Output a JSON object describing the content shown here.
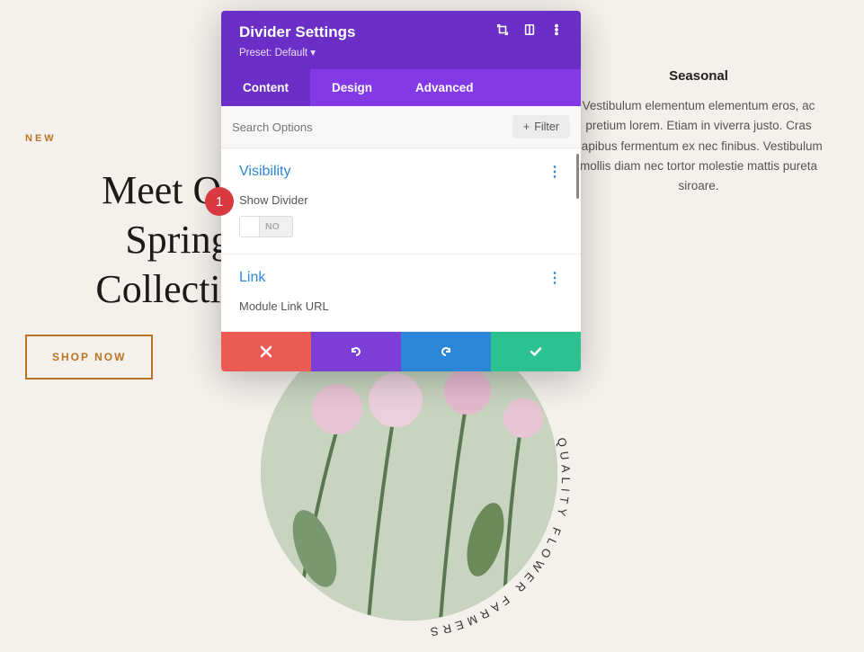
{
  "background": {
    "label_new": "NEW",
    "hero_line1": "Meet Our",
    "hero_line2": "Spring",
    "hero_line3": "Collection",
    "shop_button": "SHOP NOW",
    "curved_text": "QUALITY FLOWER FARMERS",
    "right": {
      "title": "Seasonal",
      "body": "Vestibulum elementum elementum eros, ac pretium lorem. Etiam in viverra justo. Cras dapibus fermentum ex nec finibus. Vestibulum mollis diam nec tortor molestie mattis pureta siroare."
    }
  },
  "annotation": {
    "badge1": "1"
  },
  "modal": {
    "title": "Divider Settings",
    "preset_label": "Preset: Default",
    "tabs": {
      "content": "Content",
      "design": "Design",
      "advanced": "Advanced",
      "active": "content"
    },
    "search": {
      "placeholder": "Search Options",
      "filter_label": "Filter"
    },
    "sections": {
      "visibility": {
        "title": "Visibility",
        "show_divider_label": "Show Divider",
        "show_divider_value": "NO"
      },
      "link": {
        "title": "Link",
        "url_label": "Module Link URL"
      }
    }
  }
}
